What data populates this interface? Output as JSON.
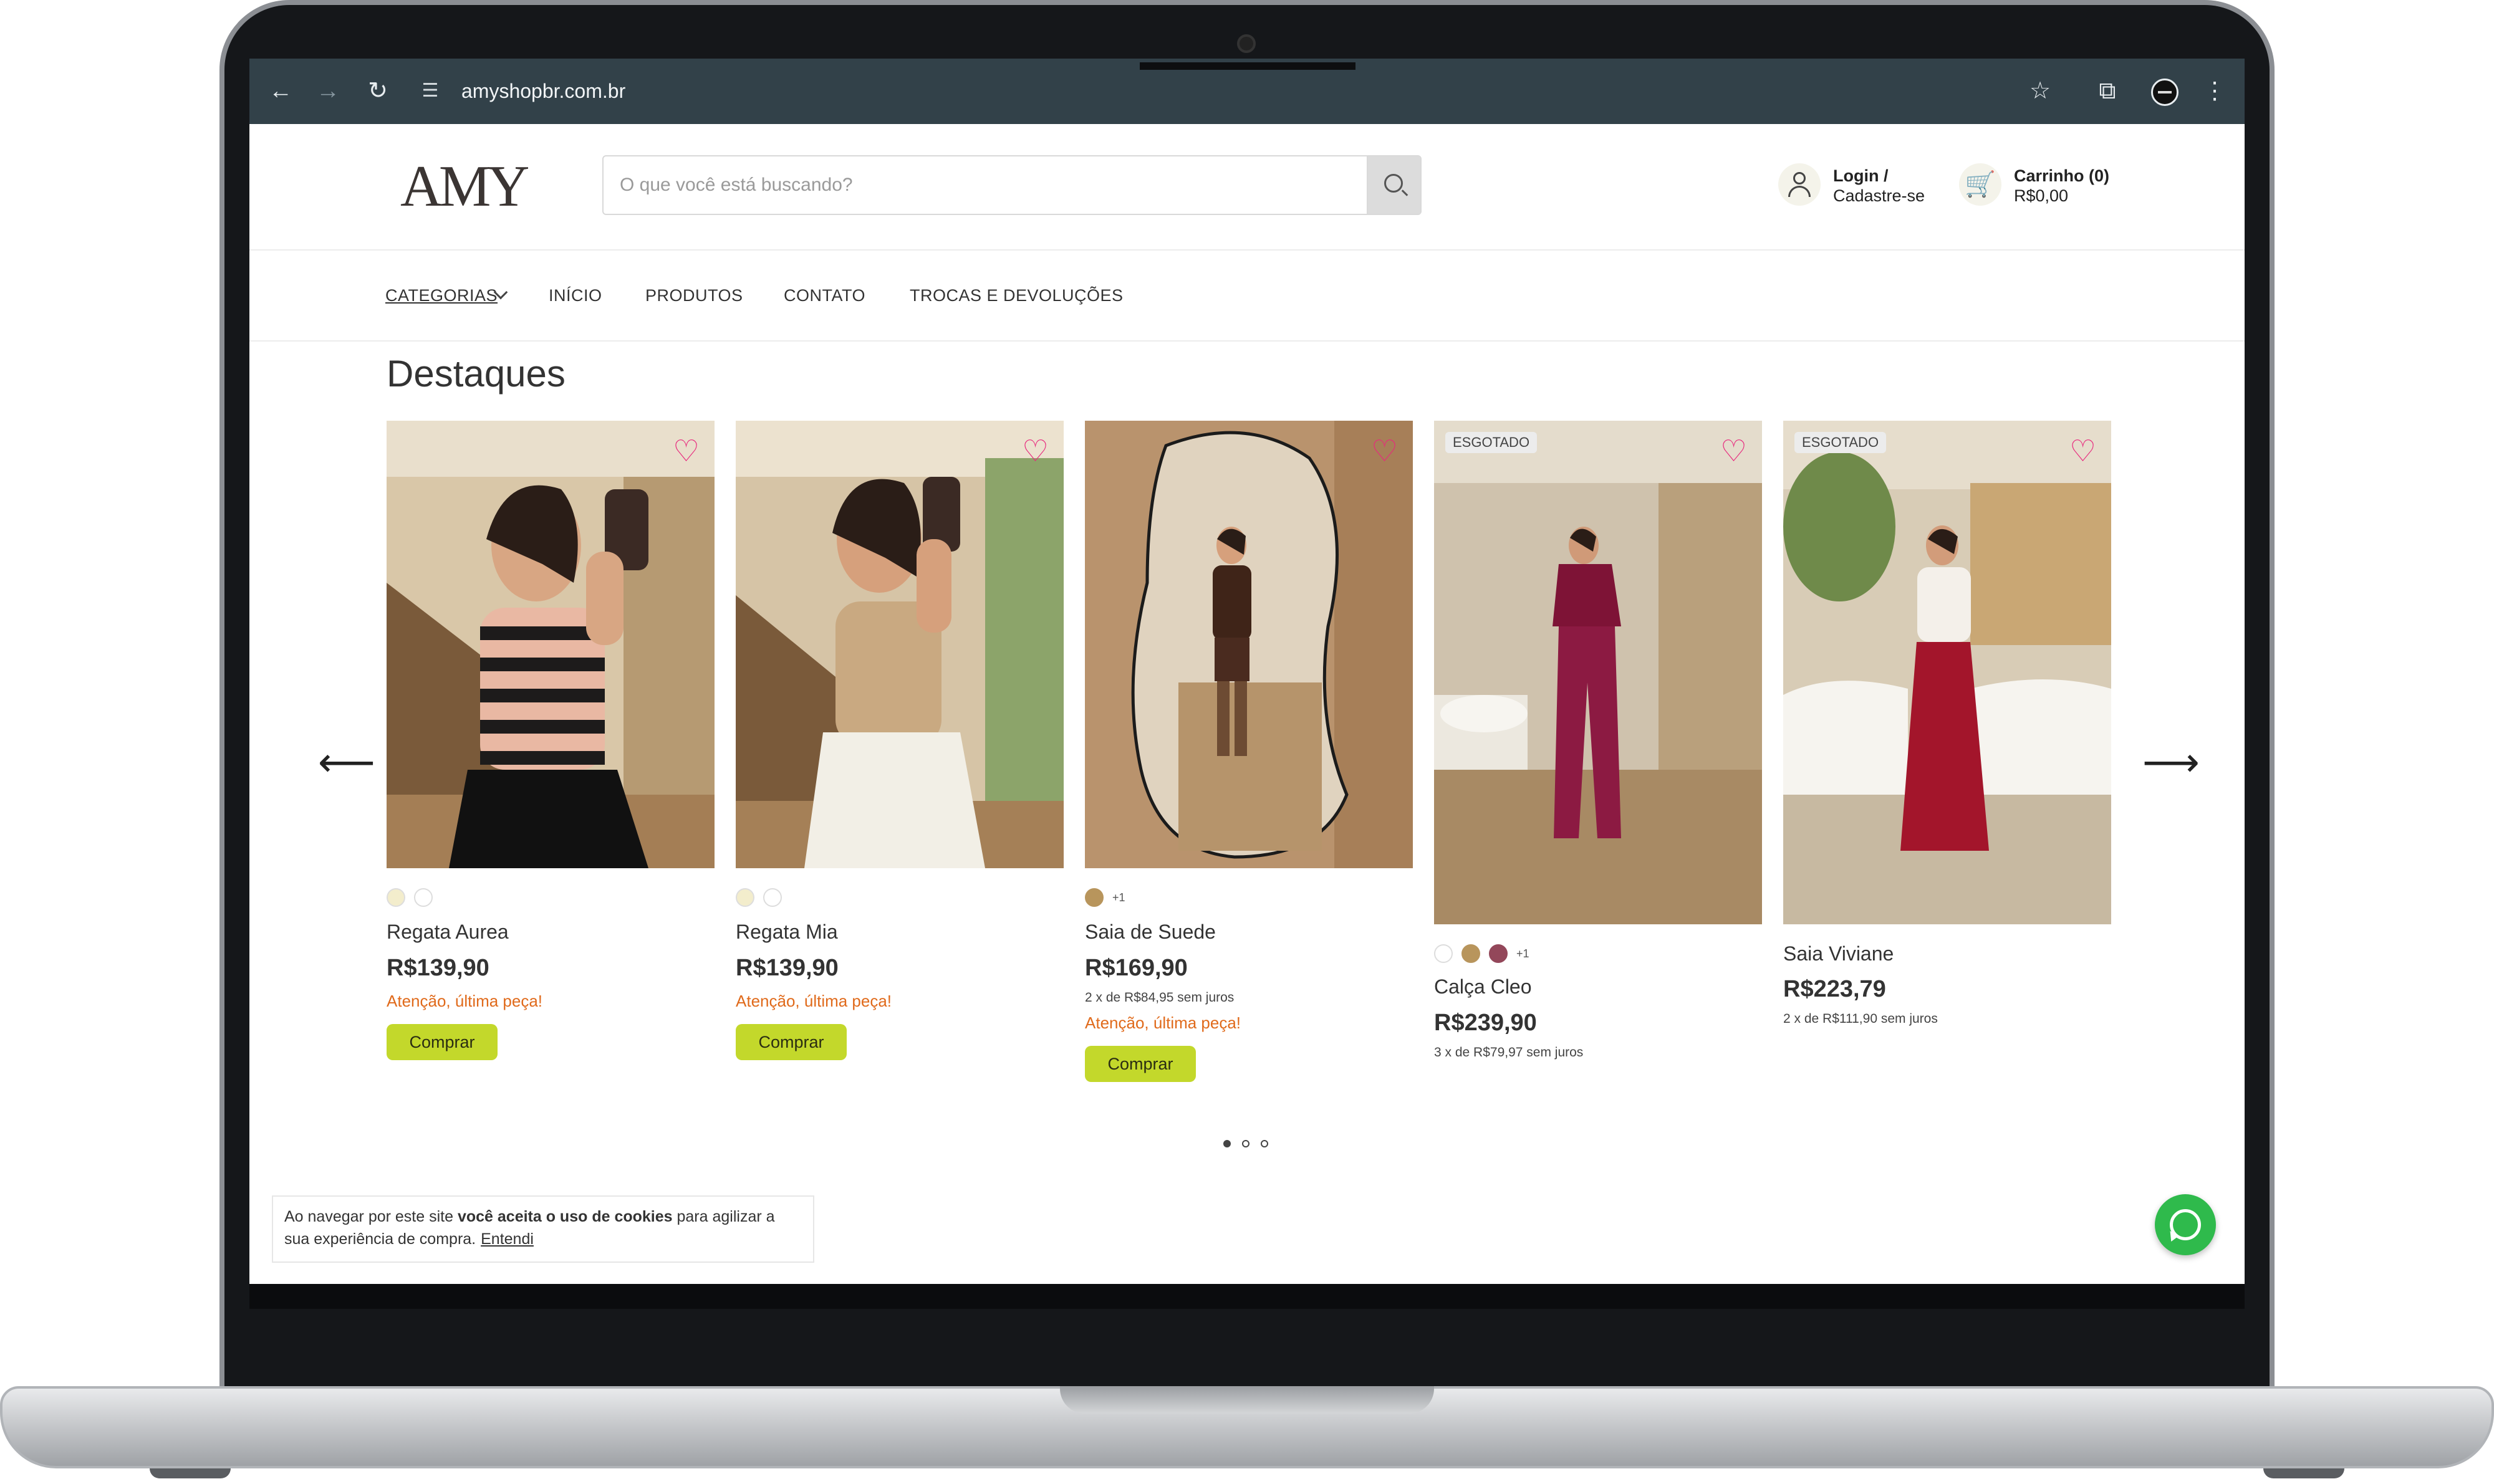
{
  "browser": {
    "url": "amyshopbr.com.br",
    "back_icon": "arrow-left-icon",
    "forward_icon": "arrow-right-icon",
    "reload_icon": "reload-icon",
    "bookmark_icon": "star-icon",
    "extensions_icon": "puzzle-icon",
    "menu_icon": "kebab-menu-icon"
  },
  "header": {
    "logo_text": "AMY",
    "search_placeholder": "O que você está buscando?",
    "login_line1": "Login /",
    "login_line2": "Cadastre-se",
    "cart_line1": "Carrinho (0)",
    "cart_line2": "R$0,00"
  },
  "nav": {
    "categories": "CATEGORIAS",
    "home": "INÍCIO",
    "products": "PRODUTOS",
    "contact": "CONTATO",
    "returns": "TROCAS E DEVOLUÇÕES"
  },
  "section_title": "Destaques",
  "products": [
    {
      "name": "Regata Aurea",
      "price": "R$139,90",
      "alert": "Atenção, última peça!",
      "buy": "Comprar"
    },
    {
      "name": "Regata Mia",
      "price": "R$139,90",
      "alert": "Atenção, última peça!",
      "buy": "Comprar"
    },
    {
      "name": "Saia de Suede",
      "price": "R$169,90",
      "installments": "2 x de R$84,95 sem juros",
      "alert": "Atenção, última peça!",
      "buy": "Comprar",
      "more_colors": "+1"
    },
    {
      "name": "Calça Cleo",
      "price": "R$239,90",
      "installments": "3 x de R$79,97 sem juros",
      "badge": "ESGOTADO",
      "more_colors": "+1"
    },
    {
      "name": "Saia Viviane",
      "price": "R$223,79",
      "installments": "2 x de R$111,90 sem juros",
      "badge": "ESGOTADO"
    }
  ],
  "colors": {
    "accent_button": "#c3d82b",
    "alert_text": "#e06a1b",
    "heart": "#e8287d",
    "browser_bar": "#324149",
    "whatsapp": "#2fba4c"
  },
  "cookie": {
    "text_before": "Ao navegar por este site ",
    "text_bold": "você aceita o uso de cookies",
    "text_after": " para agilizar a sua experiência de compra.",
    "link": "Entendi"
  },
  "carousel": {
    "page_count": 3,
    "active_page": 1
  }
}
